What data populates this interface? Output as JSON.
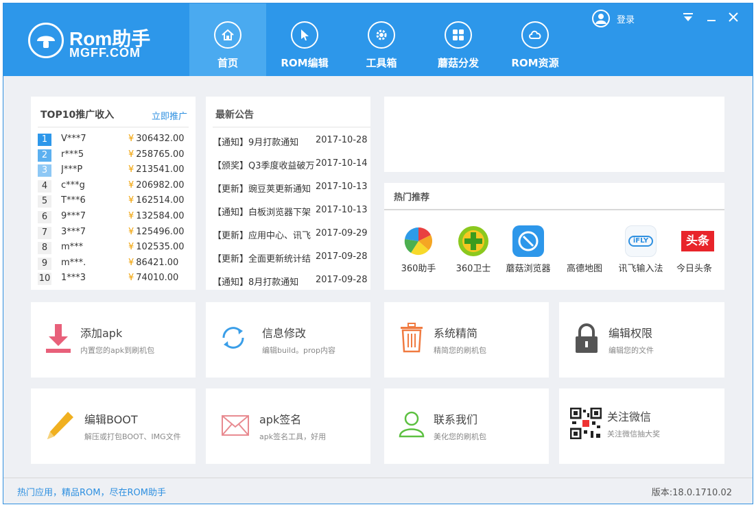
{
  "logo": {
    "name": "Rom助手",
    "sub": "MGFF.COM"
  },
  "nav": [
    {
      "label": "首页",
      "icon": "home-icon"
    },
    {
      "label": "ROM编辑",
      "icon": "cursor-icon"
    },
    {
      "label": "工具箱",
      "icon": "gear-icon"
    },
    {
      "label": "蘑菇分发",
      "icon": "grid-icon"
    },
    {
      "label": "ROM资源",
      "icon": "cloud-icon"
    }
  ],
  "header": {
    "login_label": "登录"
  },
  "top10": {
    "title": "TOP10推广收入",
    "link": "立即推广",
    "currency": "¥",
    "rows": [
      {
        "rank": "1",
        "user": "V***7",
        "amount": "306432.00"
      },
      {
        "rank": "2",
        "user": "r***5",
        "amount": "258765.00"
      },
      {
        "rank": "3",
        "user": "J***P",
        "amount": "213541.00"
      },
      {
        "rank": "4",
        "user": "c***g",
        "amount": "206982.00"
      },
      {
        "rank": "5",
        "user": "T***6",
        "amount": "162514.00"
      },
      {
        "rank": "6",
        "user": "9***7",
        "amount": "132584.00"
      },
      {
        "rank": "7",
        "user": "3***7",
        "amount": "125496.00"
      },
      {
        "rank": "8",
        "user": "m***",
        "amount": "102535.00"
      },
      {
        "rank": "9",
        "user": "m***.",
        "amount": "86421.00"
      },
      {
        "rank": "10",
        "user": "1***3",
        "amount": "74010.00"
      }
    ]
  },
  "notice": {
    "title": "最新公告",
    "items": [
      {
        "text": "【通知】9月打款通知",
        "date": "2017-10-28"
      },
      {
        "text": "【颁奖】Q3季度收益破万",
        "date": "2017-10-14"
      },
      {
        "text": "【更新】豌豆荚更新通知",
        "date": "2017-10-13"
      },
      {
        "text": "【通知】白板浏览器下架",
        "date": "2017-10-13"
      },
      {
        "text": "【更新】应用中心、讯飞",
        "date": "2017-09-29"
      },
      {
        "text": "【更新】全面更新统计结",
        "date": "2017-09-28"
      },
      {
        "text": "【通知】8月打款通知",
        "date": "2017-09-28"
      }
    ]
  },
  "hot": {
    "title": "热门推荐",
    "apps": [
      {
        "name": "360助手"
      },
      {
        "name": "360卫士"
      },
      {
        "name": "蘑菇浏览器"
      },
      {
        "name": "高德地图"
      },
      {
        "name": "讯飞输入法",
        "badge": "iFLY"
      },
      {
        "name": "今日头条",
        "badge": "头条"
      }
    ]
  },
  "tools": [
    {
      "title": "添加apk",
      "desc": "内置您的apk到刷机包",
      "icon": "download-icon",
      "color": "#e8607a"
    },
    {
      "title": "信息修改",
      "desc": "编辑build。prop内容",
      "icon": "refresh-icon",
      "color": "#3a9ee8"
    },
    {
      "title": "系统精简",
      "desc": "精简您的刷机包",
      "icon": "trash-icon",
      "color": "#f07a40"
    },
    {
      "title": "编辑权限",
      "desc": "编辑您的文件",
      "icon": "lock-icon",
      "color": "#555555"
    },
    {
      "title": "编辑BOOT",
      "desc": "解压或打包BOOT、IMG文件",
      "icon": "pencil-icon",
      "color": "#f0b020"
    },
    {
      "title": "apk签名",
      "desc": "apk签名工具，好用",
      "icon": "envelope-icon",
      "color": "#e88a90"
    },
    {
      "title": "联系我们",
      "desc": "美化您的刷机包",
      "icon": "user-icon",
      "color": "#5cc040"
    },
    {
      "title": "关注微信",
      "desc": "关注微信抽大奖",
      "icon": "qrcode-icon",
      "color": "#222222"
    }
  ],
  "footer": {
    "slogan": "热门应用，精品ROM，尽在ROM助手",
    "version": "版本:18.0.1710.02"
  }
}
